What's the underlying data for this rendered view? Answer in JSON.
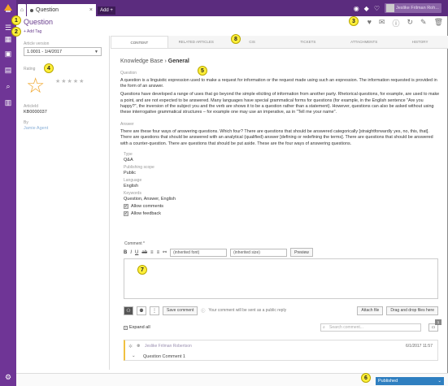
{
  "colors": {
    "brand": "#6f3596",
    "accent": "#2f7fc0",
    "callout": "#ffef3a"
  },
  "tabs": {
    "question_tab": "Question",
    "add_tab": "Add +"
  },
  "user": {
    "name": "Jeslike Frilman Roh..."
  },
  "header": {
    "title": "Question",
    "add_tag": "+ Add Tag"
  },
  "left": {
    "version_label": "Article version",
    "version_value": "1.0001 - 1/4/2017",
    "rating_label": "Rating",
    "rating_stars_value": 0,
    "article_label": "ArticleId",
    "article_value": "KB0000037",
    "by_label": "By",
    "by_value": "Jamie Agent"
  },
  "content_tabs": [
    "Content",
    "Related Articles",
    "CIs",
    "Tickets",
    "Attachments",
    "History"
  ],
  "breadcrumb": {
    "root": "Knowledge Base",
    "current": "General"
  },
  "question": {
    "label": "Question",
    "p1": "A question is a linguistic expression used to make a request for information or the request made using such an expression. The information requested is provided in the form of an answer.",
    "p2": "Questions have developed a range of uses that go beyond the simple eliciting of information from another party. Rhetorical questions, for example, are used to make a point, and are not expected to be answered. Many languages have special grammatical forms for questions (for example, in the English sentence \"Are you happy?\", the inversion of the subject you and the verb are shows it to be a question rather than a statement). However, questions can also be asked without using these interrogative grammatical structures – for example one may use an imperative, as in \"Tell me your name\"."
  },
  "answer": {
    "label": "Answer",
    "text": "There are these four ways of answering questions. Which four? There are questions that should be answered categorically [straightforwardly yes, no, this, that]. There are questions that should be answered with an analytical (qualified) answer [defining or redefining the terms]. There are questions that should be answered with a counter-question. There are questions that should be put aside. These are the four ways of answering questions."
  },
  "meta": {
    "type_label": "Type",
    "type_value": "Q&A",
    "scope_label": "Publishing scope",
    "scope_value": "Public",
    "lang_label": "Language",
    "lang_value": "English",
    "kw_label": "Keywords",
    "kw_value": "Question, Answer, English"
  },
  "options": {
    "allow_comments": "Allow comments",
    "allow_feedback": "Allow feedback"
  },
  "editor": {
    "comment_label": "Comment *",
    "font": "(inherited font)",
    "size": "(inherited size)",
    "preview": "Preview"
  },
  "comment_bar": {
    "save": "Save comment",
    "public_note": "Your comment will be sent as a public reply",
    "attach": "Attach file",
    "drop": "Drag and drop files here"
  },
  "comments": {
    "expand_all": "Expand all",
    "search_placeholder": "Search comment...",
    "count": "1",
    "author": "Jeslike Frilman Robertson",
    "date": "6/1/2017 11:57",
    "title": "Question Comment 1"
  },
  "status": {
    "value": "Published"
  },
  "callouts": [
    "1",
    "2",
    "3",
    "4",
    "5",
    "6",
    "7",
    "8"
  ]
}
